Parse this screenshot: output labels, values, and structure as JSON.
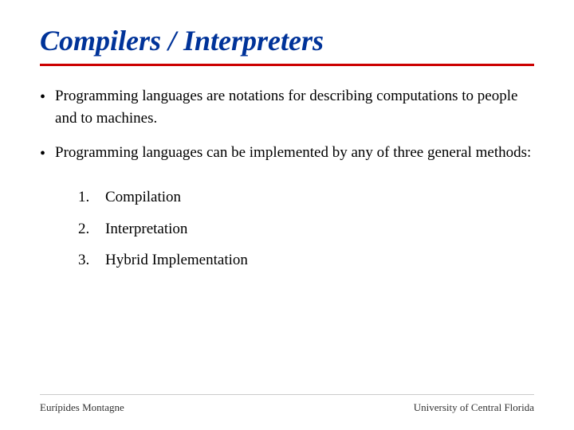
{
  "slide": {
    "title": "Compilers / Interpreters",
    "bullets": [
      {
        "id": "bullet-1",
        "text": "Programming languages are notations for describing computations to people and to machines."
      },
      {
        "id": "bullet-2",
        "text": "Programming languages can be implemented by any of three general methods:"
      }
    ],
    "numbered_items": [
      {
        "number": "1.",
        "text": "Compilation"
      },
      {
        "number": "2.",
        "text": "Interpretation"
      },
      {
        "number": "3.",
        "text": "Hybrid Implementation"
      }
    ],
    "footer": {
      "left": "Eurípides Montagne",
      "right": "University of Central Florida"
    }
  }
}
